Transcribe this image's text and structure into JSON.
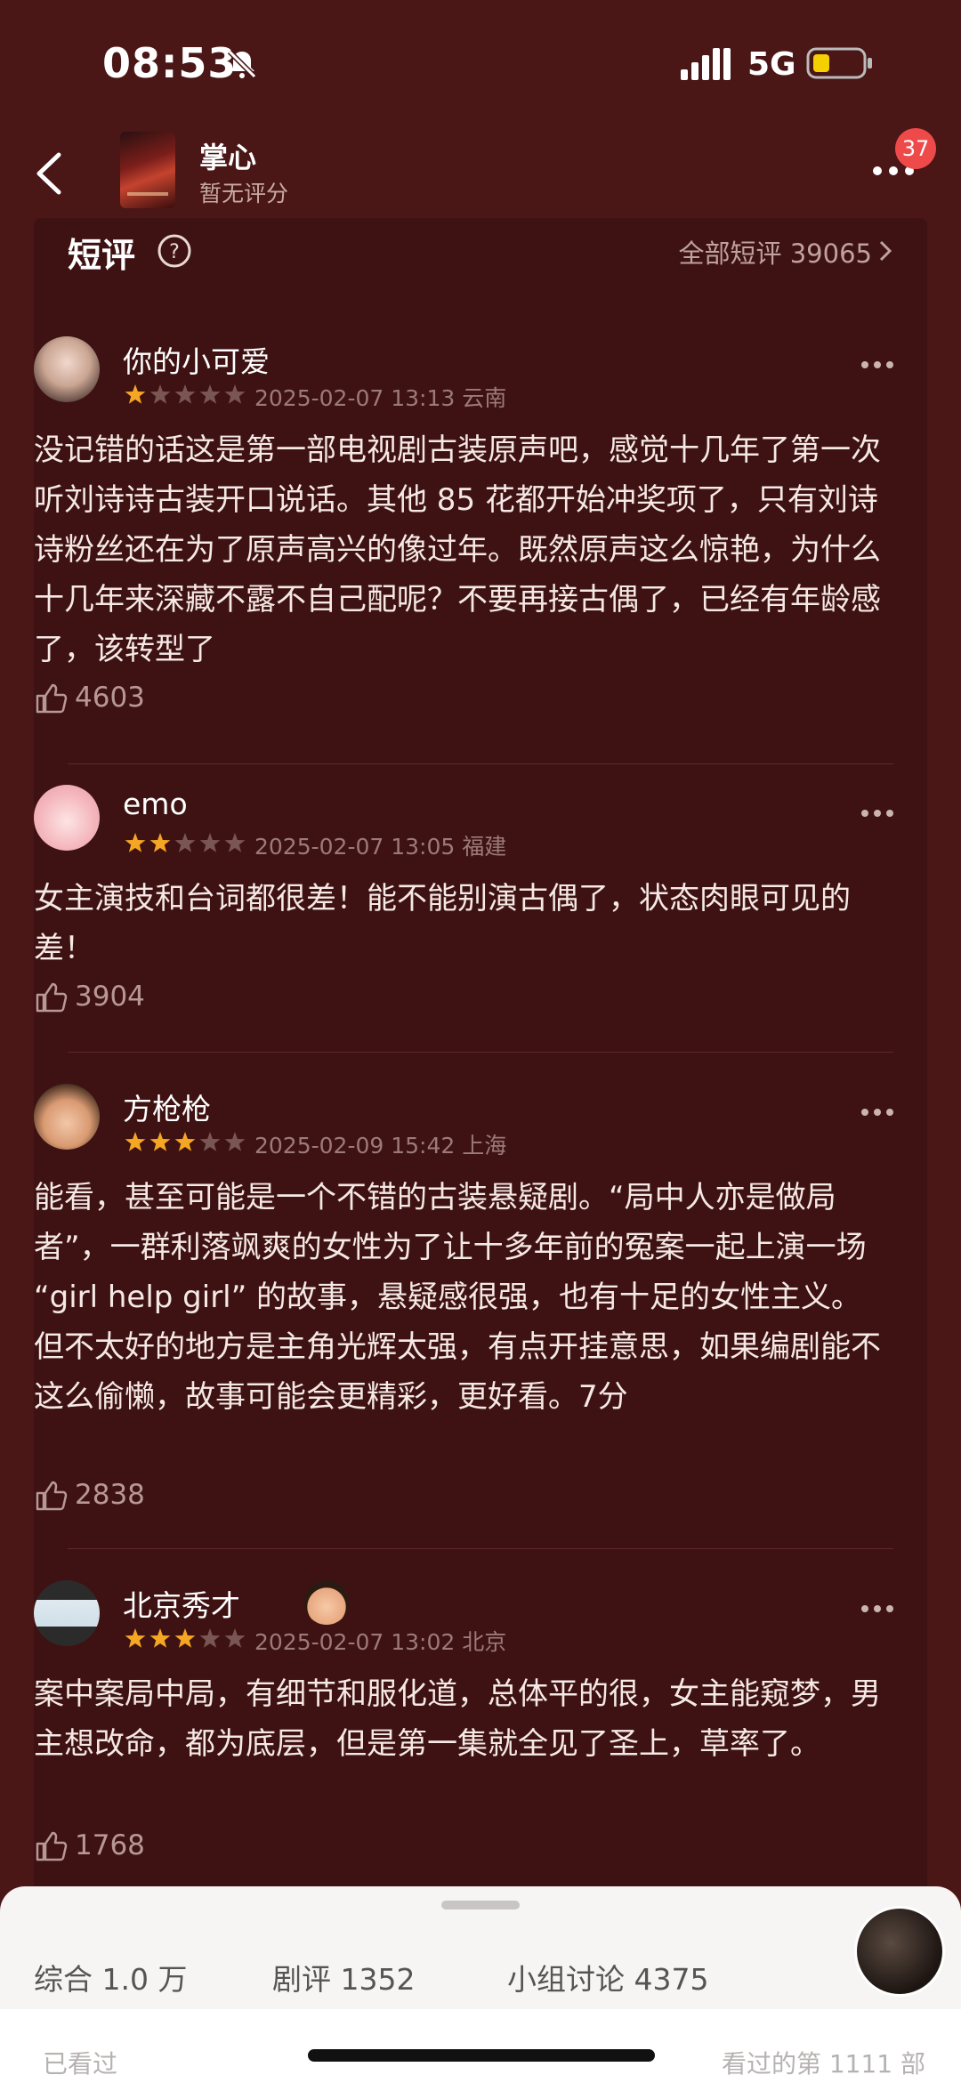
{
  "status": {
    "time": "08:53",
    "network": "5G"
  },
  "header": {
    "title": "掌心",
    "subtitle": "暂无评分",
    "badge": "37"
  },
  "section": {
    "title": "短评",
    "all_label": "全部短评 39065"
  },
  "reviews": [
    {
      "user": "你的小可爱",
      "stars": 1,
      "date": "2025-02-07 13:13",
      "location": "云南",
      "text": "没记错的话这是第一部电视剧古装原声吧，感觉十几年了第一次听刘诗诗古装开口说话。其他 85 花都开始冲奖项了，只有刘诗诗粉丝还在为了原声高兴的像过年。既然原声这么惊艳，为什么十几年来深藏不露不自己配呢？不要再接古偶了，已经有年龄感了，该转型了",
      "likes": "4603"
    },
    {
      "user": "emo",
      "stars": 2,
      "date": "2025-02-07 13:05",
      "location": "福建",
      "text": "女主演技和台词都很差！能不能别演古偶了，状态肉眼可见的差！",
      "likes": "3904"
    },
    {
      "user": "方枪枪",
      "stars": 3,
      "date": "2025-02-09 15:42",
      "location": "上海",
      "text": "能看，甚至可能是一个不错的古装悬疑剧。“局中人亦是做局者”，一群利落飒爽的女性为了让十多年前的冤案一起上演一场 “girl help girl” 的故事，悬疑感很强，也有十足的女性主义。但不太好的地方是主角光辉太强，有点开挂意思，如果编剧能不这么偷懒，故事可能会更精彩，更好看。7分",
      "likes": "2838"
    },
    {
      "user": "北京秀才",
      "stars": 3,
      "date": "2025-02-07 13:02",
      "location": "北京",
      "text": "案中案局中局，有细节和服化道，总体平的很，女主能窥梦，男主想改命，都为底层，但是第一集就全见了圣上，草率了。",
      "likes": "1768"
    }
  ],
  "bottom_tabs": [
    "综合 1.0 万",
    "剧评 1352",
    "小组讨论 4375"
  ],
  "bottom_strip": {
    "left": "已看过",
    "right": "看过的第 1111 部"
  },
  "colors": {
    "star_on": "#f5a623",
    "star_off": "#7a5652",
    "background": "#4a1616"
  }
}
